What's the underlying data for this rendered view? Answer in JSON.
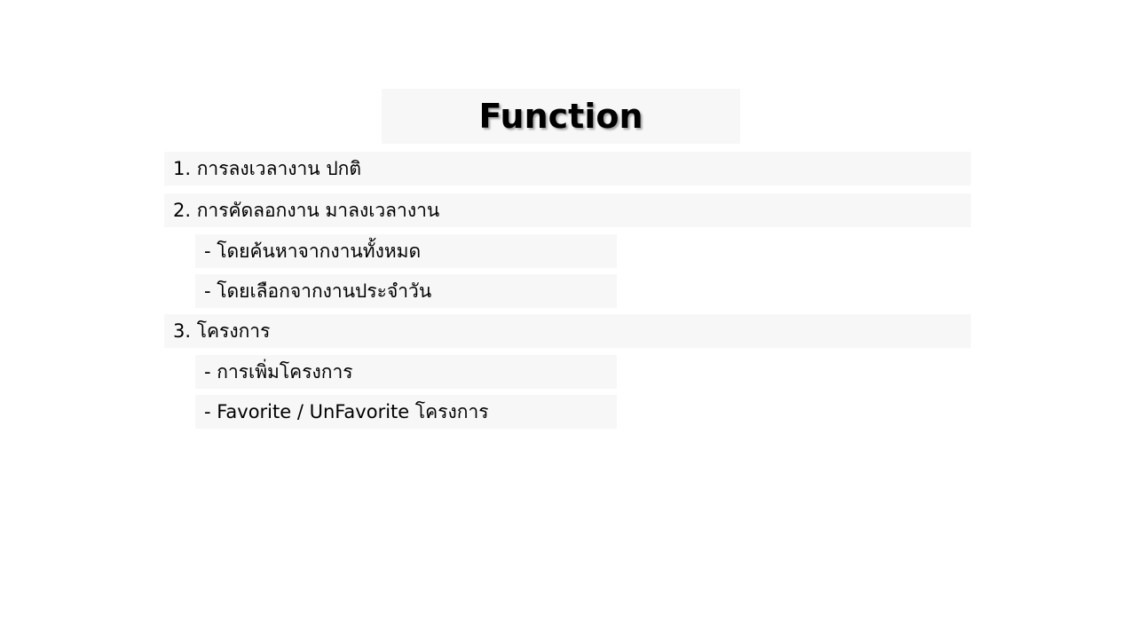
{
  "slide": {
    "title": "Function",
    "items": [
      {
        "text": "1. การลงเวลางาน ปกติ"
      },
      {
        "text": "2. การคัดลอกงาน มาลงเวลางาน"
      },
      {
        "text": "- โดยค้นหาจากงานทั้งหมด"
      },
      {
        "text": "- โดยเลือกจากงานประจำวัน"
      },
      {
        "text": "3. โครงการ"
      },
      {
        "text": "- การเพิ่มโครงการ"
      },
      {
        "text": "- Favorite / UnFavorite โครงการ"
      }
    ]
  }
}
